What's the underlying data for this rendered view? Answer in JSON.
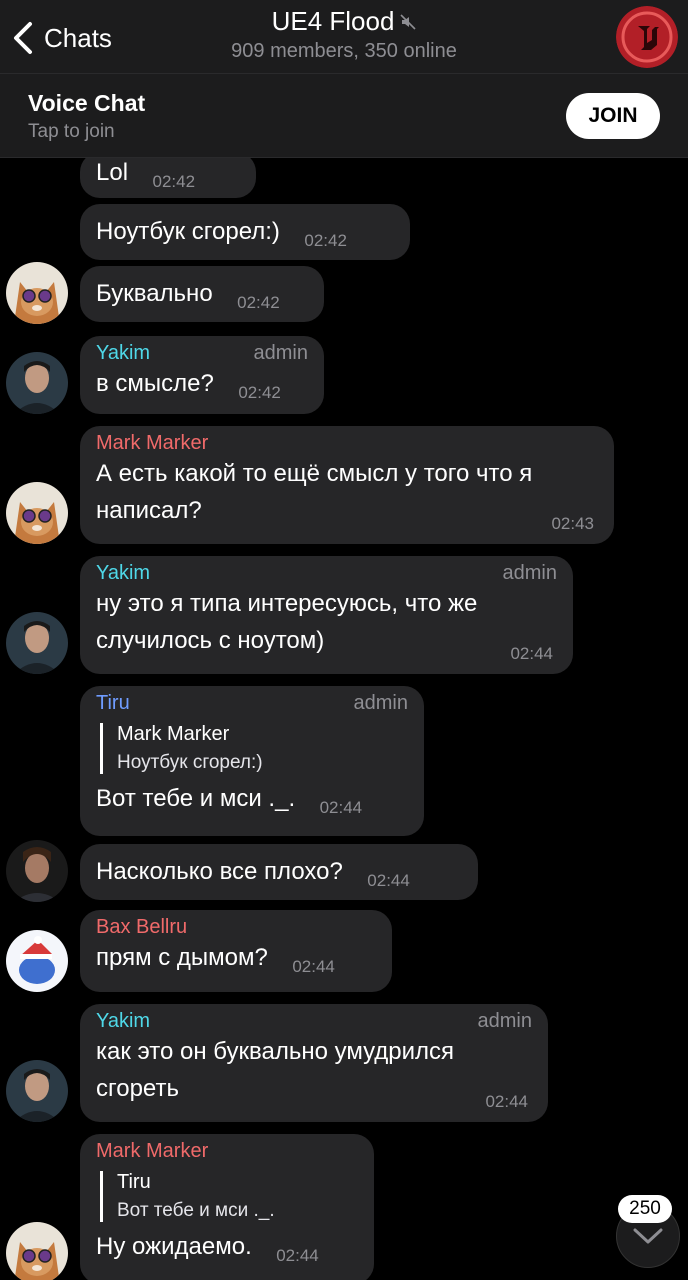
{
  "header": {
    "back_label": "Chats",
    "title": "UE4 Flood",
    "subtitle": "909 members, 350 online",
    "muted_icon": "mute-icon",
    "avatar_icon": "unreal-engine-logo"
  },
  "voice_chat": {
    "title": "Voice Chat",
    "subtitle": "Tap to join",
    "join_label": "JOIN"
  },
  "colors": {
    "yakim": "#4fd8e8",
    "mark": "#f06a6a",
    "tiru": "#6f9cff",
    "bax": "#f06a6a",
    "bubble": "#262628"
  },
  "messages": [
    {
      "text": "Lol",
      "time": "02:42"
    },
    {
      "text": "Ноутбук сгорел:)",
      "time": "02:42"
    },
    {
      "text": "Буквально",
      "time": "02:42"
    },
    {
      "sender": "Yakim",
      "role": "admin",
      "text": "в смысле?",
      "time": "02:42"
    },
    {
      "sender": "Mark Marker",
      "text": "А есть какой то ещё смысл у того что я написал?",
      "time": "02:43"
    },
    {
      "sender": "Yakim",
      "role": "admin",
      "text": "ну это я типа интересуюсь, что же случилось с ноутом)",
      "time": "02:44"
    },
    {
      "sender": "Tiru",
      "role": "admin",
      "quote": {
        "name": "Mark Marker",
        "text": "Ноутбук сгорел:)"
      },
      "text": "Вот тебе и мси ._.",
      "time": "02:44"
    },
    {
      "text": "Насколько все плохо?",
      "time": "02:44"
    },
    {
      "sender": "Bax Bellru",
      "text": "прям с дымом?",
      "time": "02:44"
    },
    {
      "sender": "Yakim",
      "role": "admin",
      "text": "как это он буквально умудрился сгореть",
      "time": "02:44"
    },
    {
      "sender": "Mark Marker",
      "quote": {
        "name": "Tiru",
        "text": "Вот тебе и мси ._."
      },
      "text": "Ну ожидаемо.",
      "time": "02:44"
    }
  ],
  "unread_badge": "250"
}
